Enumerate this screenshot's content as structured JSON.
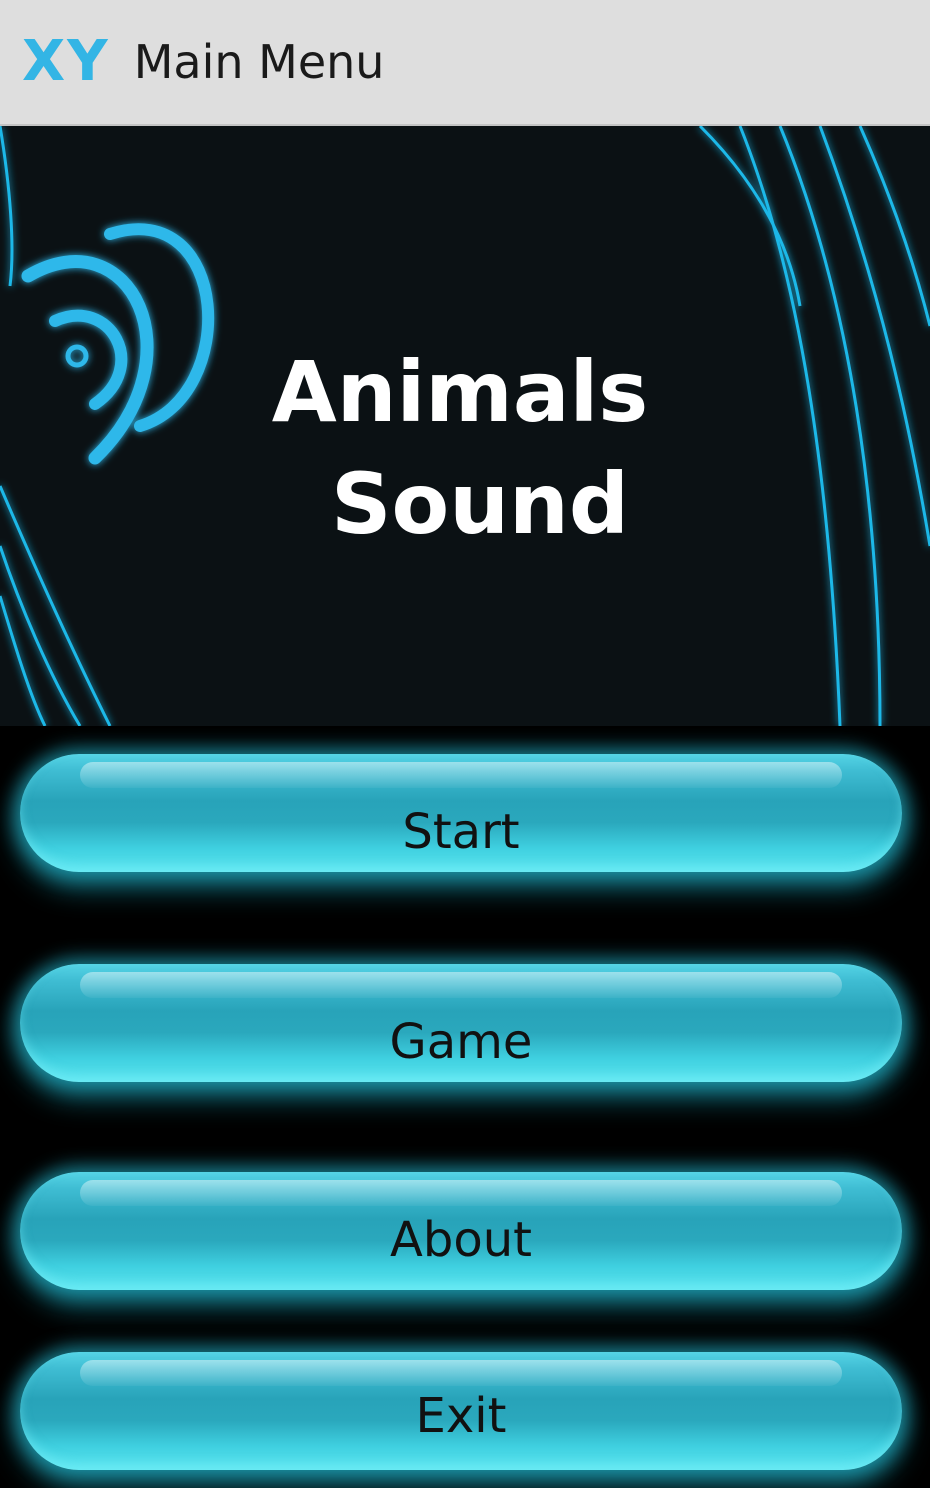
{
  "action_bar": {
    "logo_text": "XY",
    "title": "Main Menu"
  },
  "banner": {
    "title_line1": "Animals",
    "title_line2": "Sound",
    "icon": "sound-waves-icon"
  },
  "menu": {
    "buttons": [
      {
        "label": "Start"
      },
      {
        "label": "Game"
      },
      {
        "label": "About"
      },
      {
        "label": "Exit"
      }
    ]
  },
  "colors": {
    "accent": "#33b5e5",
    "button_cyan": "#3fc8da",
    "banner_bg": "#0b1114",
    "action_bar_bg": "#dedede"
  }
}
